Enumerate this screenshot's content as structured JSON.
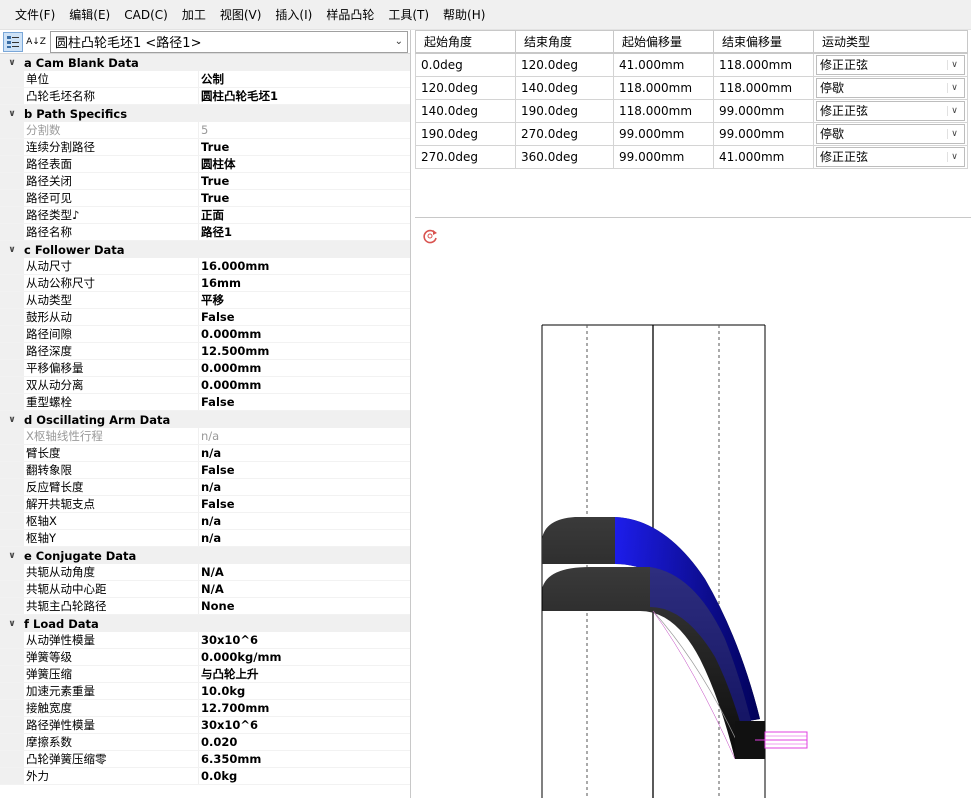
{
  "menu": [
    "文件(F)",
    "编辑(E)",
    "CAD(C)",
    "加工",
    "视图(V)",
    "插入(I)",
    "样品凸轮",
    "工具(T)",
    "帮助(H)"
  ],
  "toolbar": {
    "categorized_icon": "categorized-view-icon",
    "sort_icon": "alphabetical-sort-icon",
    "sort_label": "A↓Z",
    "object_selector": "圆柱凸轮毛坯1 <路径1>"
  },
  "properties": [
    {
      "category": "a Cam Blank Data",
      "items": [
        {
          "name": "单位",
          "value": "公制"
        },
        {
          "name": "凸轮毛坯名称",
          "value": "圆柱凸轮毛坯1"
        }
      ]
    },
    {
      "category": "b Path Specifics",
      "items": [
        {
          "name": "分割数",
          "value": "5",
          "disabled": true
        },
        {
          "name": "连续分割路径",
          "value": "True"
        },
        {
          "name": "路径表面",
          "value": "圆柱体"
        },
        {
          "name": "路径关闭",
          "value": "True"
        },
        {
          "name": "路径可见",
          "value": "True"
        },
        {
          "name": "路径类型♪",
          "value": "正面"
        },
        {
          "name": "路径名称",
          "value": "路径1"
        }
      ]
    },
    {
      "category": "c Follower Data",
      "items": [
        {
          "name": "从动尺寸",
          "value": "16.000mm"
        },
        {
          "name": "从动公称尺寸",
          "value": "16mm"
        },
        {
          "name": "从动类型",
          "value": "平移"
        },
        {
          "name": "鼓形从动",
          "value": "False"
        },
        {
          "name": "路径间隙",
          "value": "0.000mm"
        },
        {
          "name": "路径深度",
          "value": "12.500mm"
        },
        {
          "name": "平移偏移量",
          "value": "0.000mm"
        },
        {
          "name": "双从动分离",
          "value": "0.000mm"
        },
        {
          "name": "重型螺栓",
          "value": "False"
        }
      ]
    },
    {
      "category": "d Oscillating Arm Data",
      "items": [
        {
          "name": "X枢轴线性行程",
          "value": "n/a",
          "disabled": true
        },
        {
          "name": "臂长度",
          "value": "n/a"
        },
        {
          "name": "翻转象限",
          "value": "False"
        },
        {
          "name": "反应臂长度",
          "value": "n/a"
        },
        {
          "name": "解开共轭支点",
          "value": "False"
        },
        {
          "name": "枢轴X",
          "value": "n/a"
        },
        {
          "name": "枢轴Y",
          "value": "n/a"
        }
      ]
    },
    {
      "category": "e Conjugate Data",
      "items": [
        {
          "name": "共轭从动角度",
          "value": "N/A"
        },
        {
          "name": "共轭从动中心距",
          "value": "N/A"
        },
        {
          "name": "共轭主凸轮路径",
          "value": "None"
        }
      ]
    },
    {
      "category": "f Load Data",
      "items": [
        {
          "name": "从动弹性模量",
          "value": "30x10^6"
        },
        {
          "name": "弹簧等级",
          "value": "0.000kg/mm"
        },
        {
          "name": "弹簧压缩",
          "value": "与凸轮上升"
        },
        {
          "name": "加速元素重量",
          "value": "10.0kg"
        },
        {
          "name": "接触宽度",
          "value": "12.700mm"
        },
        {
          "name": "路径弹性模量",
          "value": "30x10^6"
        },
        {
          "name": "摩擦系数",
          "value": "0.020"
        },
        {
          "name": "凸轮弹簧压缩零",
          "value": "6.350mm"
        },
        {
          "name": "外力",
          "value": "0.0kg"
        }
      ]
    }
  ],
  "segment_table": {
    "headers": [
      "起始角度",
      "结束角度",
      "起始偏移量",
      "结束偏移量",
      "运动类型"
    ],
    "rows": [
      [
        "0.0deg",
        "120.0deg",
        "41.000mm",
        "118.000mm",
        "修正正弦"
      ],
      [
        "120.0deg",
        "140.0deg",
        "118.000mm",
        "118.000mm",
        "停歇"
      ],
      [
        "140.0deg",
        "190.0deg",
        "118.000mm",
        "99.000mm",
        "修正正弦"
      ],
      [
        "190.0deg",
        "270.0deg",
        "99.000mm",
        "99.000mm",
        "停歇"
      ],
      [
        "270.0deg",
        "360.0deg",
        "99.000mm",
        "41.000mm",
        "修正正弦"
      ]
    ]
  },
  "viewport": {
    "refresh_icon": "refresh-icon",
    "colors": {
      "accent": "#1a1aff",
      "body": "#111111",
      "follower": "#e040e0",
      "icon": "#d9534f"
    }
  }
}
